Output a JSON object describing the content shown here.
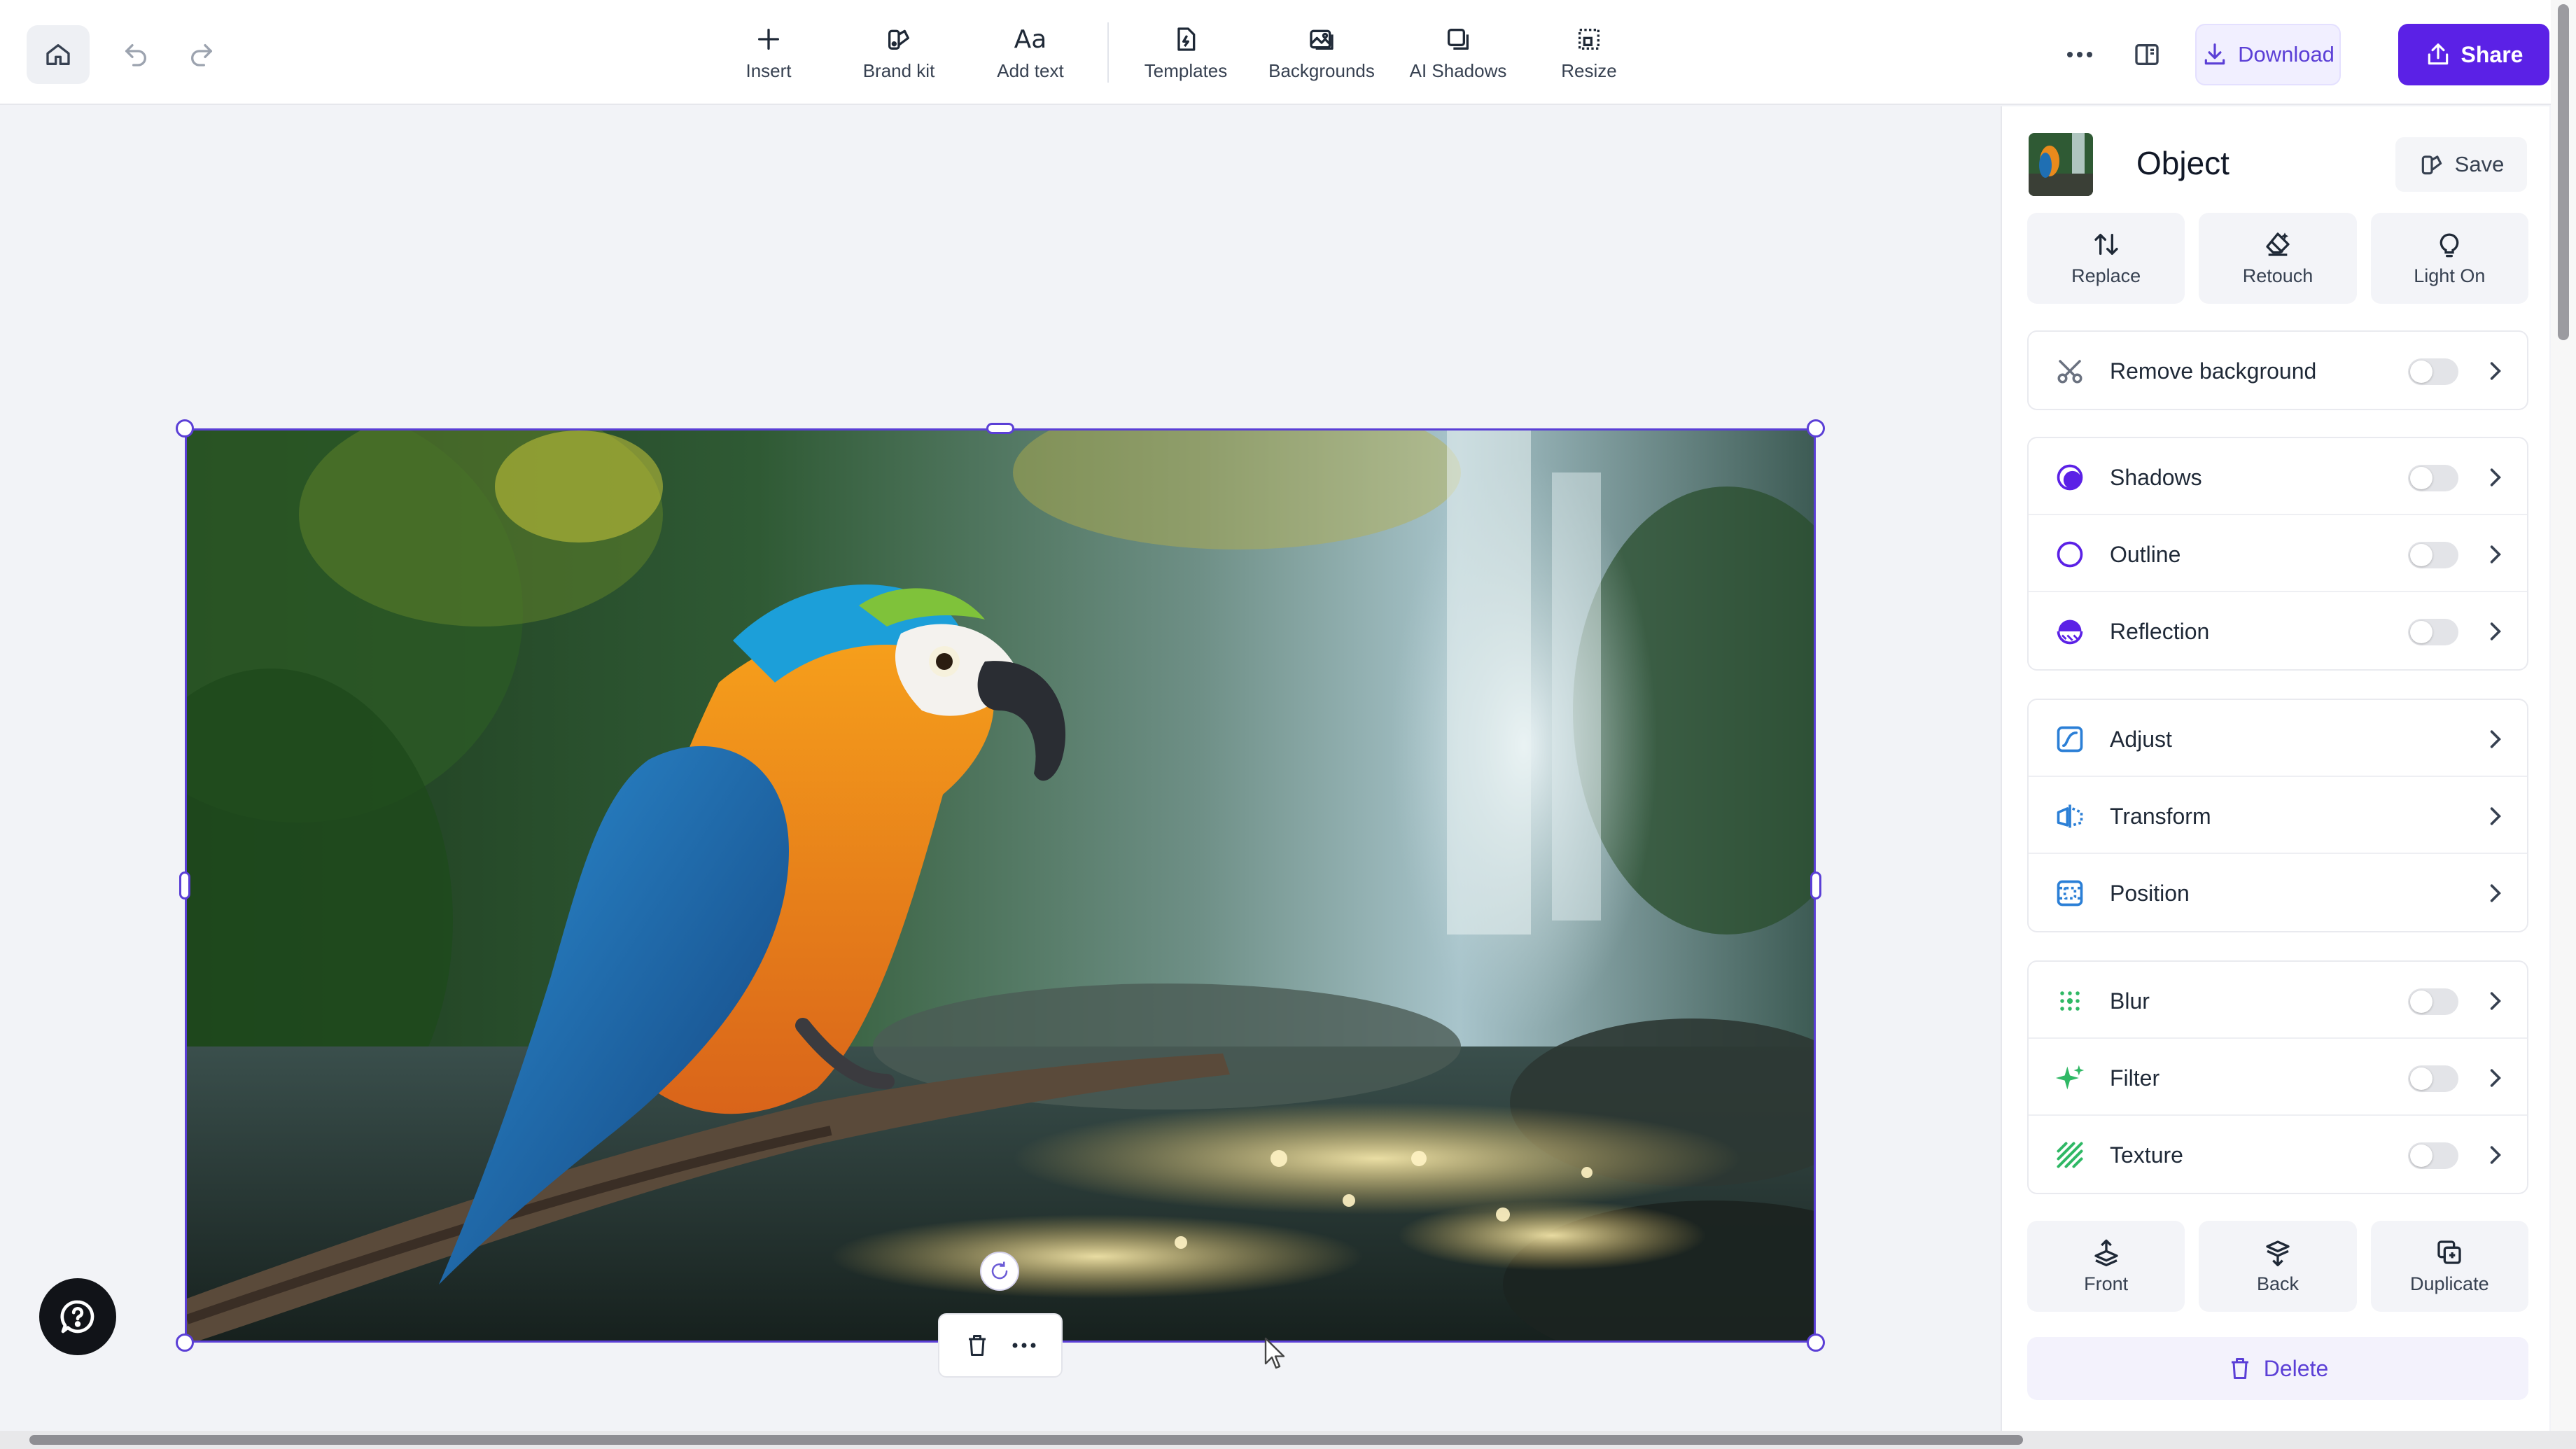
{
  "toolbar": {
    "tools": [
      {
        "label": "Insert",
        "icon": "plus-icon"
      },
      {
        "label": "Brand kit",
        "icon": "brand-kit-icon"
      },
      {
        "label": "Add text",
        "icon": "text-icon"
      },
      {
        "label": "Templates",
        "icon": "templates-icon"
      },
      {
        "label": "Backgrounds",
        "icon": "backgrounds-icon"
      },
      {
        "label": "AI Shadows",
        "icon": "ai-shadows-icon"
      },
      {
        "label": "Resize",
        "icon": "resize-icon"
      }
    ],
    "download_label": "Download",
    "share_label": "Share"
  },
  "panel": {
    "title": "Object",
    "save_label": "Save",
    "quick_actions": [
      {
        "label": "Replace",
        "icon": "replace-icon"
      },
      {
        "label": "Retouch",
        "icon": "retouch-icon"
      },
      {
        "label": "Light On",
        "icon": "lightbulb-icon"
      }
    ],
    "remove_background": {
      "label": "Remove background",
      "enabled": false
    },
    "effects": [
      {
        "label": "Shadows",
        "enabled": false
      },
      {
        "label": "Outline",
        "enabled": false
      },
      {
        "label": "Reflection",
        "enabled": false
      }
    ],
    "edits": [
      {
        "label": "Adjust"
      },
      {
        "label": "Transform"
      },
      {
        "label": "Position"
      }
    ],
    "filters": [
      {
        "label": "Blur",
        "enabled": false
      },
      {
        "label": "Filter",
        "enabled": false
      },
      {
        "label": "Texture",
        "enabled": false
      }
    ],
    "arrange": [
      {
        "label": "Front",
        "icon": "bring-front-icon"
      },
      {
        "label": "Back",
        "icon": "send-back-icon"
      },
      {
        "label": "Duplicate",
        "icon": "duplicate-icon"
      }
    ],
    "delete_label": "Delete"
  },
  "colors": {
    "accent": "#5b21e6",
    "selection": "#5b3fd6",
    "panel_bg": "#ffffff",
    "canvas_bg": "#f2f3f7"
  }
}
